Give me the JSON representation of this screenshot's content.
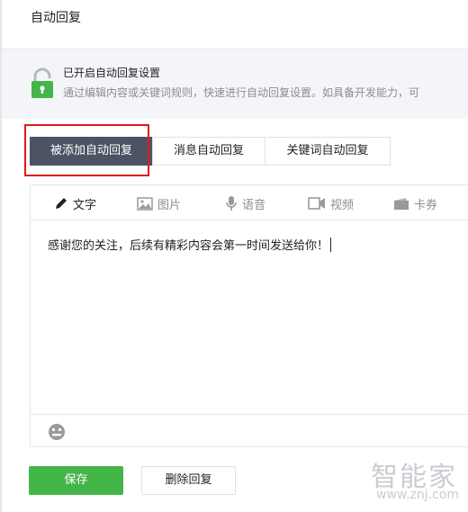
{
  "page": {
    "title": "自动回复"
  },
  "notice": {
    "title": "已开启自动回复设置",
    "description": "通过编辑内容或关键词规则，快速进行自动回复设置。如具备开发能力，可",
    "icon": "lock-icon",
    "icon_color": "#44b549"
  },
  "tabs": [
    {
      "label": "被添加自动回复",
      "active": true
    },
    {
      "label": "消息自动回复",
      "active": false
    },
    {
      "label": "关键词自动回复",
      "active": false
    }
  ],
  "editor": {
    "tools": [
      {
        "label": "文字",
        "icon": "pencil-icon",
        "active": true
      },
      {
        "label": "图片",
        "icon": "image-icon",
        "active": false
      },
      {
        "label": "语音",
        "icon": "microphone-icon",
        "active": false
      },
      {
        "label": "视频",
        "icon": "video-icon",
        "active": false
      },
      {
        "label": "卡券",
        "icon": "card-icon",
        "active": false
      }
    ],
    "content": "感谢您的关注，后续有精彩内容会第一时间发送给你！",
    "emoji_icon": "smiley-icon"
  },
  "actions": {
    "save_label": "保存",
    "delete_label": "删除回复"
  },
  "watermark": {
    "title": "智能家",
    "url": "www.znj.com"
  },
  "colors": {
    "accent_green": "#44b549",
    "active_tab": "#4c5364",
    "highlight_red": "#e0191d"
  }
}
